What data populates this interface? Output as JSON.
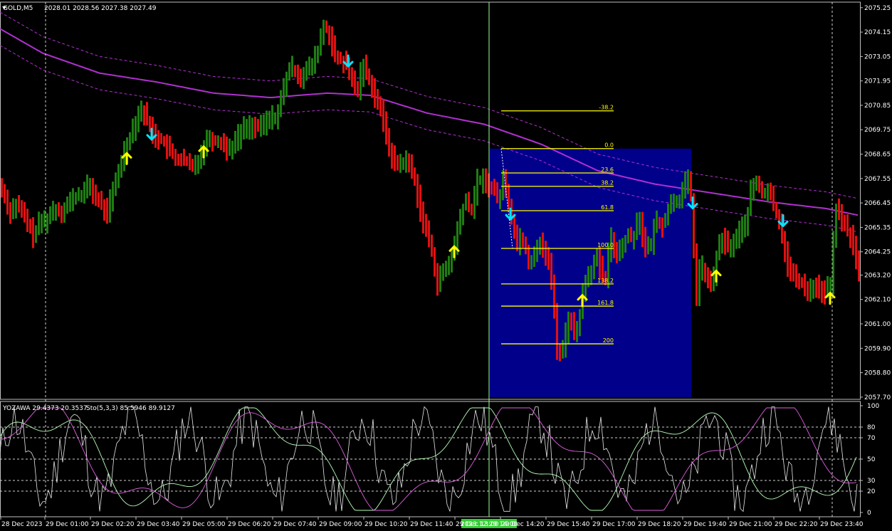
{
  "symbol_label": "GOLD,M5",
  "ohlc_label": "2028.01 2028.56 2027.38 2027.49",
  "indicator_label": "YOZAWA 29.4373 20.3537",
  "stoch_label": "Sto(5,3,3) 85.5946 89.9127",
  "crosshair_time_label": "2023.12.29 14:00",
  "colors": {
    "bull": "#1e7d12",
    "bear": "#e01010",
    "ma": "#b030d0",
    "fib": "#ffff00",
    "box": "#00008b",
    "up_arrow": "#ffff00",
    "down_arrow": "#00e5ff"
  },
  "chart_data": {
    "type": "candlestick",
    "price_axis_labels": [
      "2075.25",
      "2074.15",
      "2073.05",
      "2071.95",
      "2070.85",
      "2069.75",
      "2068.65",
      "2067.55",
      "2066.45",
      "2065.35",
      "2064.25",
      "2063.20",
      "2062.10",
      "2061.00",
      "2059.90",
      "2058.80",
      "2057.70"
    ],
    "price_range": [
      2057.6,
      2075.5
    ],
    "time_axis_labels": [
      "28 Dec 2023",
      "29 Dec 01:00",
      "29 Dec 02:20",
      "29 Dec 03:40",
      "29 Dec 05:00",
      "29 Dec 06:20",
      "29 Dec 07:40",
      "29 Dec 09:00",
      "29 Dec 10:20",
      "29 Dec 11:40",
      "29 Dec 13:00",
      "29 Dec 14:20",
      "29 Dec 15:40",
      "29 Dec 17:00",
      "29 Dec 18:20",
      "29 Dec 19:40",
      "29 Dec 21:00",
      "29 Dec 22:20",
      "29 Dec 23:40"
    ],
    "price_path": [
      [
        0,
        2067.2
      ],
      [
        6,
        2066.6
      ],
      [
        12,
        2066.0
      ],
      [
        20,
        2066.4
      ],
      [
        30,
        2066.0
      ],
      [
        40,
        2065.3
      ],
      [
        45,
        2065.0
      ],
      [
        55,
        2065.6
      ],
      [
        64,
        2065.7
      ],
      [
        74,
        2066.2
      ],
      [
        86,
        2066.1
      ],
      [
        96,
        2066.5
      ],
      [
        108,
        2066.8
      ],
      [
        116,
        2066.9
      ],
      [
        124,
        2067.3
      ],
      [
        132,
        2066.7
      ],
      [
        140,
        2066.4
      ],
      [
        148,
        2066.0
      ],
      [
        156,
        2066.8
      ],
      [
        164,
        2067.8
      ],
      [
        172,
        2068.7
      ],
      [
        180,
        2069.4
      ],
      [
        188,
        2070.1
      ],
      [
        196,
        2070.7
      ],
      [
        204,
        2070.3
      ],
      [
        212,
        2069.6
      ],
      [
        220,
        2069.4
      ],
      [
        228,
        2069.2
      ],
      [
        236,
        2068.8
      ],
      [
        244,
        2068.5
      ],
      [
        252,
        2068.4
      ],
      [
        260,
        2068.3
      ],
      [
        268,
        2068.0
      ],
      [
        276,
        2068.4
      ],
      [
        284,
        2068.9
      ],
      [
        292,
        2069.5
      ],
      [
        300,
        2069.2
      ],
      [
        308,
        2069.3
      ],
      [
        316,
        2068.9
      ],
      [
        324,
        2069.0
      ],
      [
        332,
        2069.4
      ],
      [
        340,
        2069.8
      ],
      [
        348,
        2069.9
      ],
      [
        356,
        2069.9
      ],
      [
        364,
        2069.8
      ],
      [
        372,
        2070.1
      ],
      [
        380,
        2070.3
      ],
      [
        388,
        2070.4
      ],
      [
        396,
        2071.5
      ],
      [
        404,
        2072.5
      ],
      [
        412,
        2072.5
      ],
      [
        420,
        2072.1
      ],
      [
        428,
        2072.4
      ],
      [
        436,
        2072.6
      ],
      [
        444,
        2073.2
      ],
      [
        452,
        2074.4
      ],
      [
        460,
        2074.2
      ],
      [
        468,
        2073.0
      ],
      [
        476,
        2072.9
      ],
      [
        484,
        2072.7
      ],
      [
        492,
        2072.0
      ],
      [
        500,
        2071.5
      ],
      [
        508,
        2072.7
      ],
      [
        516,
        2072.1
      ],
      [
        524,
        2071.4
      ],
      [
        532,
        2070.7
      ],
      [
        540,
        2069.7
      ],
      [
        548,
        2068.5
      ],
      [
        556,
        2068.2
      ],
      [
        564,
        2068.3
      ],
      [
        572,
        2068.3
      ],
      [
        580,
        2067.6
      ],
      [
        588,
        2066.3
      ],
      [
        596,
        2065.2
      ],
      [
        604,
        2064.5
      ],
      [
        612,
        2062.8
      ],
      [
        620,
        2063.3
      ],
      [
        628,
        2063.6
      ],
      [
        636,
        2064.4
      ],
      [
        644,
        2065.7
      ],
      [
        652,
        2066.6
      ],
      [
        660,
        2066.0
      ],
      [
        668,
        2067.4
      ],
      [
        676,
        2067.5
      ],
      [
        684,
        2067.3
      ],
      [
        692,
        2067.0
      ],
      [
        700,
        2066.6
      ],
      [
        706,
        2067.7
      ],
      [
        712,
        2066.6
      ],
      [
        718,
        2065.6
      ],
      [
        724,
        2064.6
      ],
      [
        730,
        2065.0
      ],
      [
        736,
        2064.5
      ],
      [
        742,
        2063.6
      ],
      [
        750,
        2064.4
      ],
      [
        756,
        2064.6
      ],
      [
        762,
        2064.4
      ],
      [
        770,
        2063.6
      ],
      [
        776,
        2062.0
      ],
      [
        782,
        2059.5
      ],
      [
        790,
        2060.0
      ],
      [
        798,
        2061.5
      ],
      [
        806,
        2060.3
      ],
      [
        812,
        2061.3
      ],
      [
        820,
        2063.0
      ],
      [
        828,
        2063.4
      ],
      [
        836,
        2064.0
      ],
      [
        842,
        2063.4
      ],
      [
        848,
        2062.8
      ],
      [
        856,
        2064.9
      ],
      [
        864,
        2064.2
      ],
      [
        872,
        2064.5
      ],
      [
        880,
        2065.0
      ],
      [
        888,
        2064.9
      ],
      [
        896,
        2066.0
      ],
      [
        904,
        2064.3
      ],
      [
        912,
        2064.5
      ],
      [
        920,
        2065.7
      ],
      [
        928,
        2065.4
      ],
      [
        936,
        2066.1
      ],
      [
        944,
        2066.6
      ],
      [
        952,
        2066.6
      ],
      [
        958,
        2067.0
      ],
      [
        964,
        2067.6
      ],
      [
        970,
        2066.5
      ],
      [
        976,
        2062.0
      ],
      [
        982,
        2063.8
      ],
      [
        990,
        2063.0
      ],
      [
        998,
        2062.7
      ],
      [
        1006,
        2064.2
      ],
      [
        1014,
        2064.9
      ],
      [
        1022,
        2064.4
      ],
      [
        1030,
        2064.7
      ],
      [
        1038,
        2065.2
      ],
      [
        1046,
        2065.5
      ],
      [
        1054,
        2067.1
      ],
      [
        1062,
        2067.4
      ],
      [
        1070,
        2066.8
      ],
      [
        1078,
        2067.1
      ],
      [
        1086,
        2066.2
      ],
      [
        1094,
        2065.6
      ],
      [
        1102,
        2064.0
      ],
      [
        1110,
        2063.2
      ],
      [
        1118,
        2063.0
      ],
      [
        1126,
        2062.8
      ],
      [
        1134,
        2062.5
      ],
      [
        1142,
        2062.7
      ],
      [
        1150,
        2062.6
      ],
      [
        1158,
        2062.3
      ],
      [
        1166,
        2063.0
      ],
      [
        1172,
        2066.2
      ],
      [
        1180,
        2065.8
      ],
      [
        1188,
        2065.2
      ],
      [
        1196,
        2064.8
      ],
      [
        1205,
        2063.1
      ]
    ],
    "ma_center": [
      [
        0,
        2074.3
      ],
      [
        60,
        2073.2
      ],
      [
        140,
        2072.3
      ],
      [
        220,
        2071.9
      ],
      [
        300,
        2071.4
      ],
      [
        380,
        2071.2
      ],
      [
        460,
        2071.4
      ],
      [
        520,
        2071.3
      ],
      [
        600,
        2070.5
      ],
      [
        680,
        2070.0
      ],
      [
        760,
        2069.1
      ],
      [
        840,
        2067.9
      ],
      [
        920,
        2067.3
      ],
      [
        1000,
        2066.9
      ],
      [
        1080,
        2066.5
      ],
      [
        1160,
        2066.2
      ],
      [
        1205,
        2065.9
      ]
    ],
    "ma_band_offset": 0.75,
    "fib_levels": [
      {
        "label": "-38.2",
        "price": 2070.6
      },
      {
        "label": "0.0",
        "price": 2068.9
      },
      {
        "label": "23.6",
        "price": 2067.8
      },
      {
        "label": "38.2",
        "price": 2067.2
      },
      {
        "label": "61.8",
        "price": 2066.1
      },
      {
        "label": "100.0",
        "price": 2064.4
      },
      {
        "label": "138.2",
        "price": 2062.8
      },
      {
        "label": "161.8",
        "price": 2061.8
      },
      {
        "label": "200",
        "price": 2060.1
      }
    ],
    "up_arrows": [
      [
        178,
        2068.4
      ],
      [
        286,
        2068.7
      ],
      [
        638,
        2064.2
      ],
      [
        818,
        2062.0
      ],
      [
        1006,
        2063.1
      ],
      [
        1166,
        2062.1
      ]
    ],
    "down_arrows": [
      [
        213,
        2069.6
      ],
      [
        489,
        2072.9
      ],
      [
        717,
        2066.0
      ],
      [
        973,
        2066.5
      ],
      [
        1100,
        2065.7
      ]
    ],
    "oscillator": {
      "levels": [
        100,
        80,
        70,
        50,
        30,
        20,
        0
      ],
      "dashed_levels": [
        80,
        70,
        50,
        30,
        20
      ]
    }
  }
}
